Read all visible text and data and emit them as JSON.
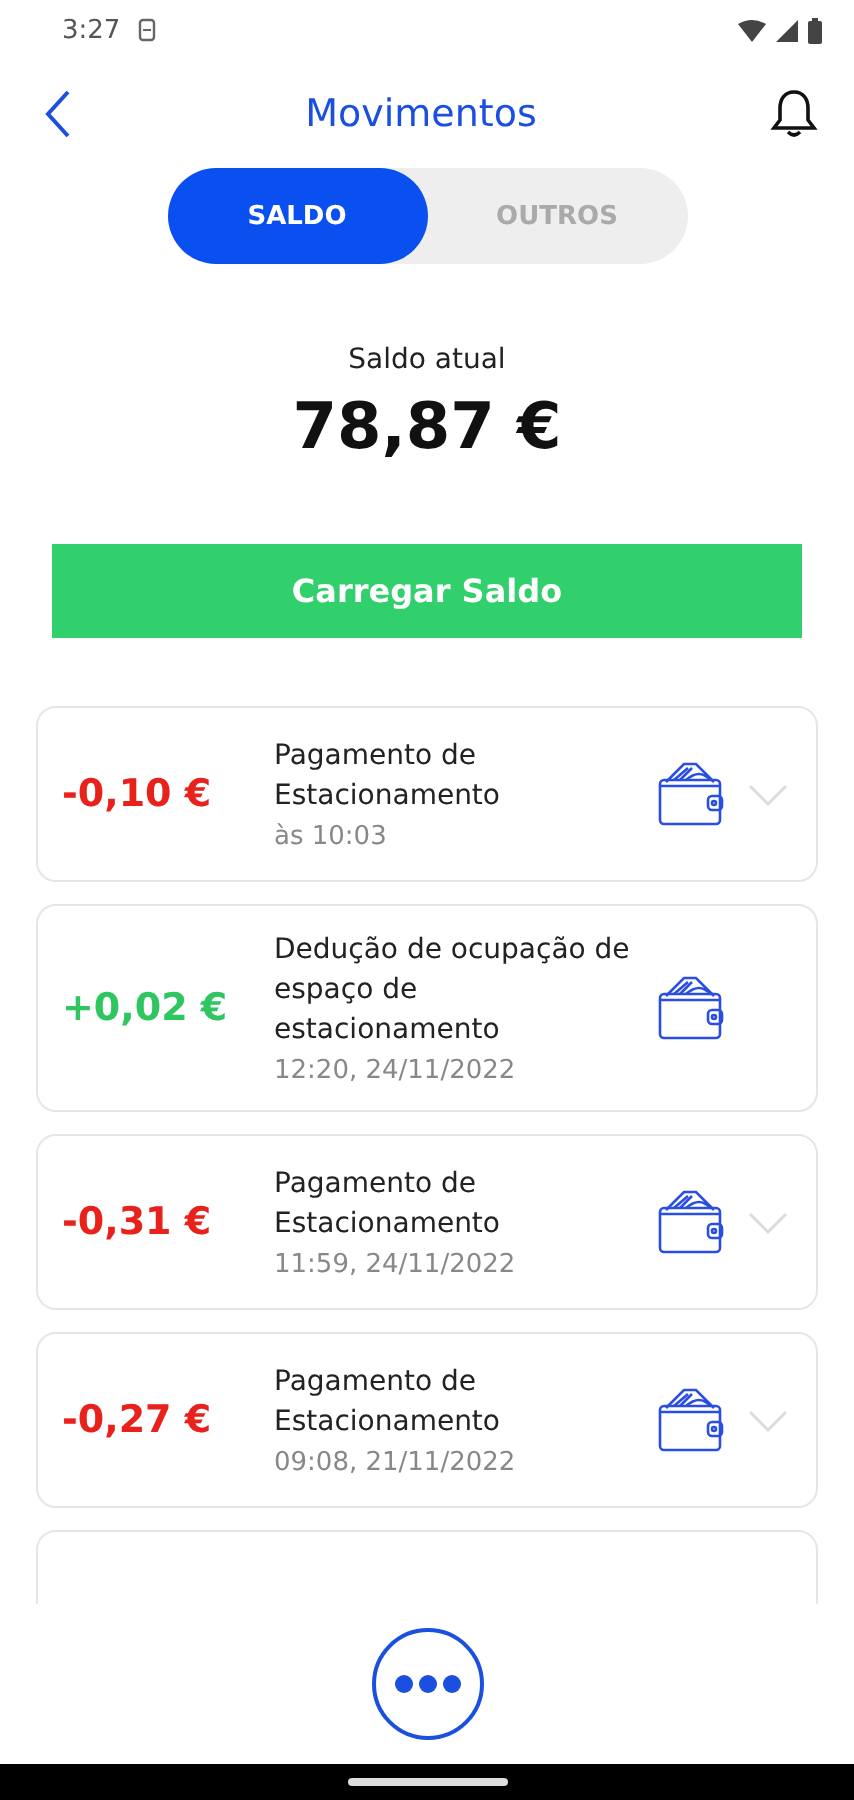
{
  "status_bar": {
    "time": "3:27"
  },
  "header": {
    "title": "Movimentos"
  },
  "tabs": [
    {
      "label": "SALDO",
      "selected": true
    },
    {
      "label": "OUTROS",
      "selected": false
    }
  ],
  "balance": {
    "label": "Saldo atual",
    "amount": "78,87 €"
  },
  "top_up_button": "Carregar Saldo",
  "transactions": [
    {
      "amount": "-0,10 €",
      "kind": "debit",
      "description": "Pagamento de Estacionamento",
      "time": "às 10:03",
      "expandable": true
    },
    {
      "amount": "+0,02 €",
      "kind": "credit",
      "description": "Dedução de ocupação de espaço de estacionamento",
      "time": "12:20, 24/11/2022",
      "expandable": false
    },
    {
      "amount": "-0,31 €",
      "kind": "debit",
      "description": "Pagamento de Estacionamento",
      "time": "11:59, 24/11/2022",
      "expandable": true
    },
    {
      "amount": "-0,27 €",
      "kind": "debit",
      "description": "Pagamento de Estacionamento",
      "time": "09:08, 21/11/2022",
      "expandable": true
    }
  ]
}
